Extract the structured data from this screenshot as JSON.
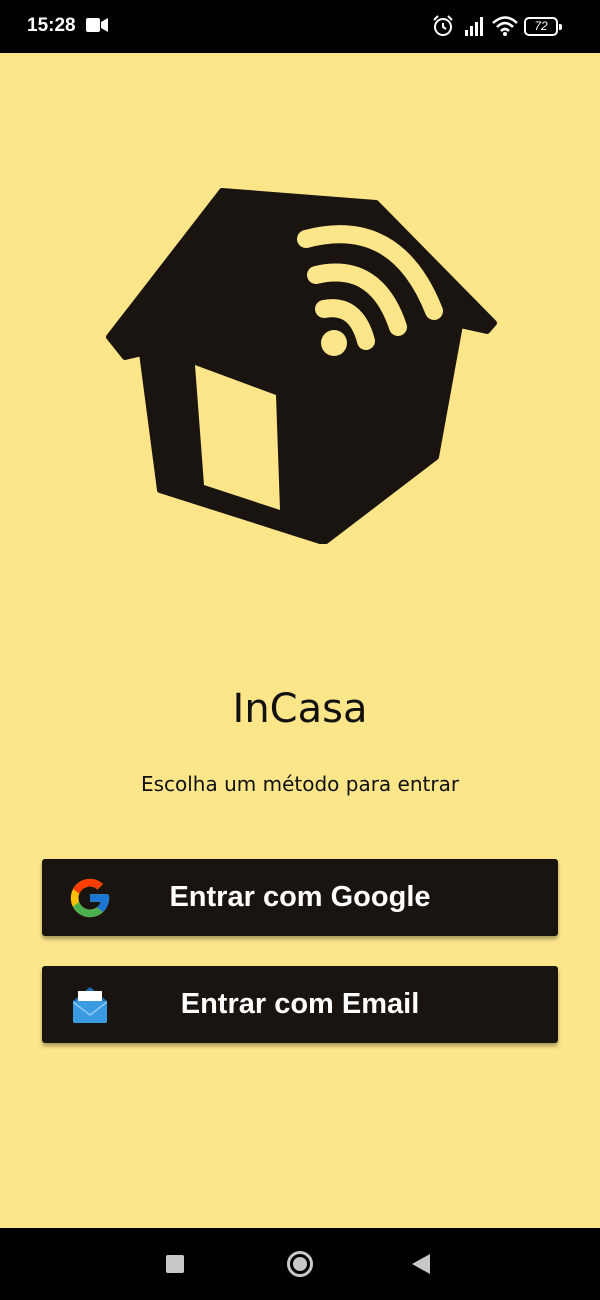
{
  "status_bar": {
    "time": "15:28",
    "battery": "72",
    "icons": [
      "video-camera-icon",
      "alarm-icon",
      "signal-icon",
      "wifi-icon",
      "battery-icon"
    ]
  },
  "logo": {
    "icon": "house-wifi-logo",
    "color": "#1a1410"
  },
  "app": {
    "title": "InCasa",
    "subtitle": "Escolha um método para entrar"
  },
  "buttons": {
    "google_label": "Entrar com Google",
    "email_label": "Entrar com Email"
  },
  "navigation": {
    "icons": [
      "recent-apps-icon",
      "home-icon",
      "back-icon"
    ]
  },
  "colors": {
    "background": "#fde68a",
    "button": "#1a1410",
    "button_text": "#ffffff"
  }
}
